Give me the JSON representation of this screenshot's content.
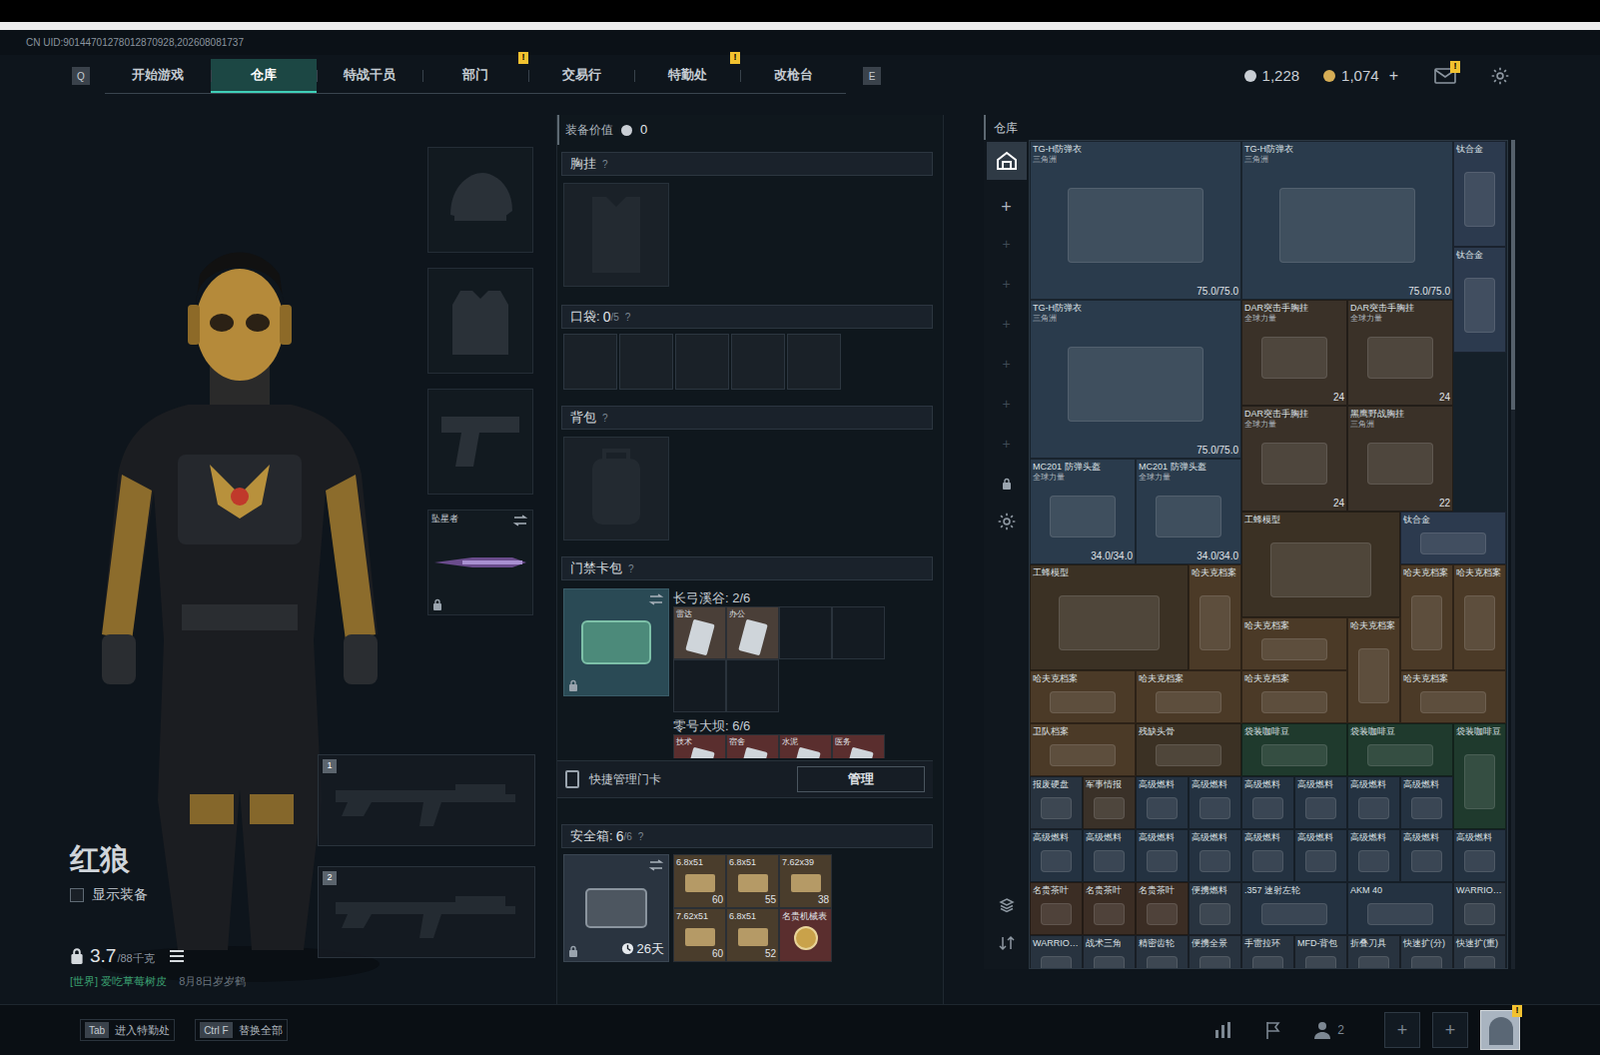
{
  "top_bar": {
    "uid": "CN UID:90144701278012870928,202608081737"
  },
  "nav": {
    "prev_key": "Q",
    "next_key": "E",
    "alert_mark": "!",
    "tabs": [
      {
        "label": "开始游戏",
        "selected": false,
        "alert": false
      },
      {
        "label": "仓库",
        "selected": true,
        "alert": false
      },
      {
        "label": "特战干员",
        "selected": false,
        "alert": false
      },
      {
        "label": "部门",
        "selected": false,
        "alert": true
      },
      {
        "label": "交易行",
        "selected": false,
        "alert": false
      },
      {
        "label": "特勤处",
        "selected": false,
        "alert": true
      },
      {
        "label": "改枪台",
        "selected": false,
        "alert": false
      }
    ]
  },
  "currencies": [
    {
      "value": "1,228",
      "color": "#c9ced4"
    },
    {
      "value": "1,074",
      "color": "#d6ad55"
    }
  ],
  "topup": "+",
  "mail": {
    "alert": true
  },
  "character": {
    "name": "红狼",
    "show_equipment": {
      "label": "显示装备",
      "checked": false
    },
    "weight": "3.7",
    "capacity": "/88千克",
    "locked": true,
    "chat": {
      "channel": "[世界] 爱吃草莓树皮",
      "extra": "8月8日岁岁鹤"
    }
  },
  "gear_slots": [
    {
      "kind": "helmet"
    },
    {
      "kind": "armor"
    },
    {
      "kind": "pistol"
    },
    {
      "kind": "melee",
      "label": "坠星者",
      "locked": true
    }
  ],
  "weapon_slots": [
    {
      "number": "1"
    },
    {
      "number": "2"
    }
  ],
  "loadout": {
    "value_label": "装备价值",
    "value": "0",
    "chest": {
      "label": "胸挂",
      "help": "?"
    },
    "pockets": {
      "label": "口袋:",
      "count": "0",
      "capacity": "/5",
      "help": "?",
      "slots": 5
    },
    "backpack": {
      "label": "背包",
      "help": "?"
    },
    "keycards": {
      "label": "门禁卡包",
      "help": "?",
      "locked": true,
      "maps": [
        {
          "title": "长弓溪谷: 2/6",
          "slots": 6,
          "cards": [
            "雷达",
            "办公"
          ]
        },
        {
          "title": "零号大坝: 6/6",
          "slots": 4,
          "cards": [
            "技术",
            "宿舍",
            "水泥",
            "医务"
          ]
        }
      ]
    },
    "quick_manage": {
      "label": "快捷管理门卡",
      "button": "管理"
    },
    "safe_box": {
      "label": "安全箱:",
      "count": "6",
      "capacity": "/6",
      "help": "?",
      "days": "26天",
      "locked": true,
      "items": [
        {
          "name": "6.8x51",
          "count": "60"
        },
        {
          "name": "6.8x51",
          "count": "55"
        },
        {
          "name": "7.62x39",
          "count": "38"
        },
        {
          "name": "7.62x51",
          "count": "60"
        },
        {
          "name": "6.8x51",
          "count": "52"
        },
        {
          "name": "名贵机械表"
        }
      ]
    }
  },
  "warehouse": {
    "title": "仓库",
    "page_add": "+",
    "items": [
      {
        "name": "TG-H防弹衣",
        "sub": "三角洲",
        "value": "75.0/75.0",
        "color": "#2a3b4c"
      },
      {
        "name": "TG-H防弹衣",
        "sub": "三角洲",
        "value": "75.0/75.0",
        "color": "#2a3b4c"
      },
      {
        "name": "钛合金",
        "color": "#2c3a4e"
      },
      {
        "name": "钛合金",
        "color": "#2c3a4e"
      },
      {
        "name": "TG-H防弹衣",
        "sub": "三角洲",
        "value": "75.0/75.0",
        "color": "#2a3b4c"
      },
      {
        "name": "DAR突击手胸挂",
        "sub": "全球力量",
        "value": "24",
        "color": "#3a3128"
      },
      {
        "name": "DAR突击手胸挂",
        "sub": "全球力量",
        "value": "24",
        "color": "#3a3128"
      },
      {
        "name": "DAR突击手胸挂",
        "sub": "全球力量",
        "value": "24",
        "color": "#3a3128"
      },
      {
        "name": "黑鹰野战胸挂",
        "sub": "三角洲",
        "value": "22",
        "color": "#3a3128"
      },
      {
        "name": "MC201 防弹头盔",
        "sub": "全球力量",
        "value": "34.0/34.0",
        "color": "#2a3b4c"
      },
      {
        "name": "MC201 防弹头盔",
        "sub": "全球力量",
        "value": "34.0/34.0",
        "color": "#2a3b4c"
      },
      {
        "name": "工蜂模型",
        "color": "#3b3124"
      },
      {
        "name": "钛合金",
        "color": "#2c3a4e"
      },
      {
        "name": "工蜂模型",
        "color": "#3b3124"
      },
      {
        "name": "哈夫克档案",
        "color": "#4b3a27"
      },
      {
        "name": "哈夫克档案",
        "color": "#4b3a27"
      },
      {
        "name": "哈夫克档案",
        "color": "#4b3a27"
      },
      {
        "name": "哈夫克档案",
        "color": "#4b3a27"
      },
      {
        "name": "哈夫克档案",
        "color": "#4b3a27"
      },
      {
        "name": "哈夫克档案",
        "color": "#4b3a27"
      },
      {
        "name": "哈夫克档案",
        "color": "#4b3a27"
      },
      {
        "name": "哈夫克档案",
        "color": "#4b3a27"
      },
      {
        "name": "哈夫克档案",
        "color": "#4b3a27"
      },
      {
        "name": "卫队档案",
        "color": "#4b3a27"
      },
      {
        "name": "残缺头骨",
        "color": "#3b3124"
      },
      {
        "name": "袋装咖啡豆",
        "color": "#1f3a2d"
      },
      {
        "name": "袋装咖啡豆",
        "color": "#1f3a2d"
      },
      {
        "name": "袋装咖啡豆",
        "color": "#1f3a2d"
      },
      {
        "name": "报废硬盘",
        "color": "#28333f"
      },
      {
        "name": "军事情报",
        "color": "#3a3128"
      },
      {
        "name": "高级燃料",
        "color": "#243241"
      },
      {
        "name": "高级燃料",
        "color": "#243241"
      },
      {
        "name": "高级燃料",
        "color": "#243241"
      },
      {
        "name": "高级燃料",
        "color": "#243241"
      },
      {
        "name": "高级燃料",
        "color": "#243241"
      },
      {
        "name": "高级燃料",
        "color": "#243241"
      },
      {
        "name": "高级燃料",
        "color": "#243241"
      },
      {
        "name": "高级燃料",
        "color": "#243241"
      },
      {
        "name": "高级燃料",
        "color": "#243241"
      },
      {
        "name": "高级燃料",
        "color": "#243241"
      },
      {
        "name": "高级燃料",
        "color": "#243241"
      },
      {
        "name": "高级燃料",
        "color": "#243241"
      },
      {
        "name": "高级燃料",
        "color": "#243241"
      },
      {
        "name": "高级燃料",
        "color": "#243241"
      },
      {
        "name": "高级燃料",
        "color": "#243241"
      },
      {
        "name": "名贵茶叶",
        "color": "#3b2d24"
      },
      {
        "name": "名贵茶叶",
        "color": "#3b2d24"
      },
      {
        "name": "名贵茶叶",
        "color": "#3b2d24"
      },
      {
        "name": "便携燃料",
        "color": "#28333f"
      },
      {
        "name": ".357 速射左轮",
        "color": "#243241"
      },
      {
        "name": "AKM 40",
        "color": "#243241"
      },
      {
        "name": "WARRIO…",
        "color": "#28333f"
      },
      {
        "name": "WARRIO…",
        "color": "#28333f"
      },
      {
        "name": "战术三角",
        "color": "#28333f"
      },
      {
        "name": "精密齿轮",
        "color": "#28333f"
      },
      {
        "name": "便携全景",
        "color": "#28333f"
      },
      {
        "name": "手雷拉环",
        "color": "#28333f"
      },
      {
        "name": "MFD-背包",
        "color": "#28333f"
      },
      {
        "name": "折叠刀具",
        "color": "#28333f"
      },
      {
        "name": "快速扩(分)",
        "color": "#28333f"
      },
      {
        "name": "快速扩(重)",
        "color": "#28333f"
      }
    ]
  },
  "bottom_bar": {
    "keys": [
      {
        "key": "Tab",
        "label": "进入特勤处"
      },
      {
        "key": "Ctrl F",
        "label": "替换全部"
      }
    ],
    "friends": "2",
    "slot_add": "+",
    "avatar_alert": true
  }
}
